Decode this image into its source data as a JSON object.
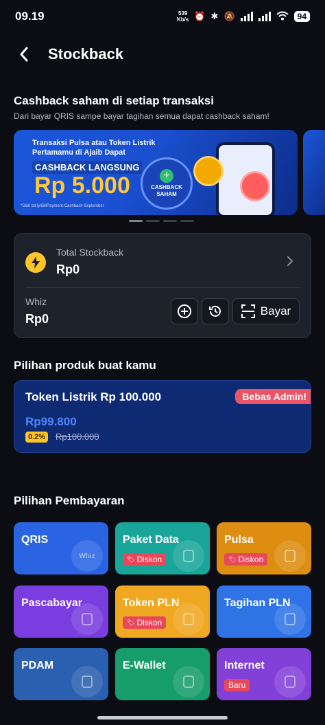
{
  "status": {
    "time": "09.19",
    "speed_value": "539",
    "speed_unit": "Kb/s",
    "battery": "94"
  },
  "header": {
    "title": "Stockback"
  },
  "promo": {
    "title": "Cashback saham di setiap transaksi",
    "subtitle": "Dari bayar QRIS sampe bayar tagihan semua dapat cashback saham!",
    "banner": {
      "line1": "Transaksi Pulsa atau Token Listrik",
      "line2": "Pertamamu di Ajaib Dapat",
      "tag": "CASHBACK LANGSUNG",
      "amount": "Rp 5.000",
      "badge_line1": "CASHBACK",
      "badge_line2": "SAHAM",
      "note": "*S&K bit.ly/BillPayment-Cashback-September"
    },
    "carousel_active_index": 0,
    "carousel_count": 4
  },
  "stockback": {
    "total_label": "Total Stockback",
    "total_value": "Rp0",
    "whiz_label": "Whiz",
    "whiz_value": "Rp0",
    "pay_label": "Bayar"
  },
  "products": {
    "section_title": "Pilihan produk buat kamu",
    "items": [
      {
        "name": "Token Listrik Rp 100.000",
        "badge": "Bebas Admin!",
        "price": "Rp99.800",
        "discount": "0.2%",
        "old_price": "Rp100.000"
      }
    ]
  },
  "payments": {
    "section_title": "Pilihan Pembayaran",
    "tiles": [
      {
        "label": "QRIS",
        "badge": "",
        "deco": "Whiz",
        "icon": "qr-code-icon",
        "color": "#2a64e3"
      },
      {
        "label": "Paket Data",
        "badge": "Diskon",
        "deco": "",
        "icon": "sim-card-icon",
        "color": "#1aa59a"
      },
      {
        "label": "Pulsa",
        "badge": "Diskon",
        "deco": "",
        "icon": "phone-icon",
        "color": "#dd8e10"
      },
      {
        "label": "Pascabayar",
        "badge": "",
        "deco": "",
        "icon": "phone-plus-icon",
        "color": "#7a3de0"
      },
      {
        "label": "Token PLN",
        "badge": "Diskon",
        "deco": "",
        "icon": "lightbulb-icon",
        "color": "#f0a722"
      },
      {
        "label": "Tagihan PLN",
        "badge": "",
        "deco": "",
        "icon": "meter-icon",
        "color": "#2f73e6"
      },
      {
        "label": "PDAM",
        "badge": "",
        "deco": "",
        "icon": "faucet-icon",
        "color": "#2b5fb0"
      },
      {
        "label": "E-Wallet",
        "badge": "",
        "deco": "",
        "icon": "wallet-icon",
        "color": "#169d6a"
      },
      {
        "label": "Internet",
        "badge": "Baru",
        "deco": "",
        "icon": "router-icon",
        "color": "#8240d8"
      }
    ]
  }
}
